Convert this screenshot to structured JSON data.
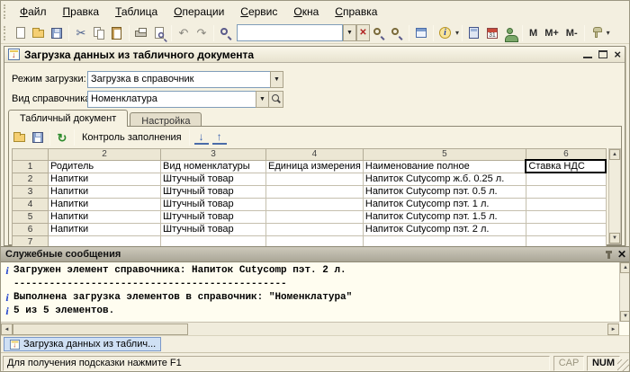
{
  "colors": {
    "background": "#f3efe0",
    "selection_blue": "#cfe0f4",
    "message_header_gray": "#aaa697",
    "grid_line": "#c5bfae",
    "accent_blue": "#3a63b0"
  },
  "menu": {
    "items": [
      "Файл",
      "Правка",
      "Таблица",
      "Операции",
      "Сервис",
      "Окна",
      "Справка"
    ]
  },
  "main_toolbar": {
    "search_value": "",
    "memory_buttons": [
      "M",
      "M+",
      "M-"
    ]
  },
  "window": {
    "title": "Загрузка данных из табличного документа",
    "fields": [
      {
        "label": "Режим загрузки:",
        "value": "Загрузка в справочник"
      },
      {
        "label": "Вид справочника:",
        "value": "Номенклатура"
      }
    ],
    "tabs": [
      {
        "label": "Табличный документ"
      },
      {
        "label": "Настройка"
      }
    ],
    "panel_toolbar": {
      "control_button": "Контроль заполнения"
    },
    "table": {
      "column_headers": [
        "",
        "2",
        "3",
        "4",
        "5",
        "6"
      ],
      "rows": [
        {
          "num": "1",
          "cells": [
            "Родитель",
            "Вид номенклатуры",
            "Единица измерения",
            "Наименование полное",
            "Ставка НДС"
          ]
        },
        {
          "num": "2",
          "cells": [
            "Напитки",
            "Штучный товар",
            "",
            "Напиток Cutycomp ж.б. 0.25 л.",
            ""
          ]
        },
        {
          "num": "3",
          "cells": [
            "Напитки",
            "Штучный товар",
            "",
            "Напиток Cutycomp пэт. 0.5 л.",
            ""
          ]
        },
        {
          "num": "4",
          "cells": [
            "Напитки",
            "Штучный товар",
            "",
            "Напиток Cutycomp пэт. 1 л.",
            ""
          ]
        },
        {
          "num": "5",
          "cells": [
            "Напитки",
            "Штучный товар",
            "",
            "Напиток Cutycomp пэт. 1.5 л.",
            ""
          ]
        },
        {
          "num": "6",
          "cells": [
            "Напитки",
            "Штучный товар",
            "",
            "Напиток Cutycomp пэт. 2 л.",
            ""
          ]
        },
        {
          "num": "7",
          "cells": [
            "",
            "",
            "",
            "",
            ""
          ]
        }
      ],
      "selected_cell": {
        "row": "1",
        "column": "6",
        "value": "Ставка НДС"
      }
    }
  },
  "messages_panel": {
    "title": "Служебные сообщения",
    "messages": [
      {
        "icon": "i",
        "text": "Загружен элемент справочника: Напиток Cutycomp пэт. 2 л."
      },
      {
        "icon": "",
        "text": "----------------------------------------------"
      },
      {
        "icon": "i",
        "text": "Выполнена загрузка элементов в справочник: \"Номенклатура\""
      },
      {
        "icon": "i",
        "text": "5 из 5 элементов."
      }
    ]
  },
  "taskbar": {
    "window_button": "Загрузка данных из таблич..."
  },
  "status_bar": {
    "hint": "Для получения подсказки нажмите F1",
    "cap": "CAP",
    "num": "NUM"
  }
}
